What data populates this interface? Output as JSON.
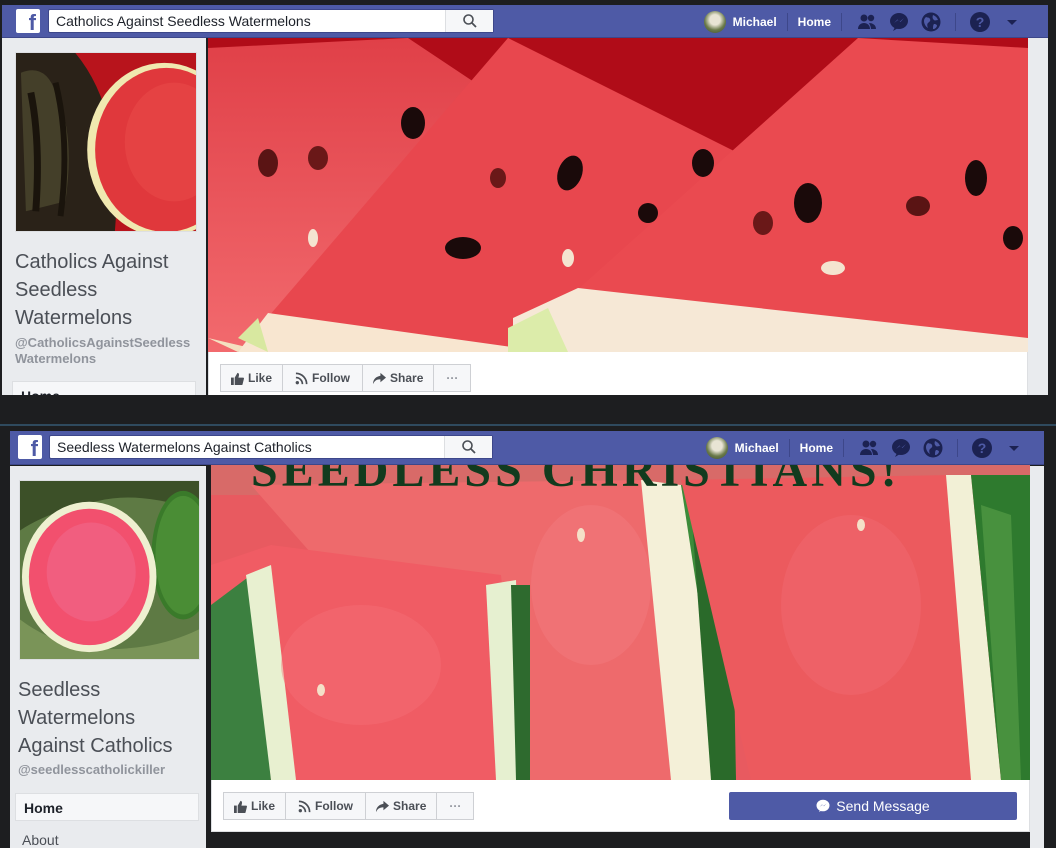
{
  "colors": {
    "brand": "#4e5aa6",
    "page_bg": "#e9ebee",
    "text_dark": "#4b4f56",
    "text_muted": "#90949c"
  },
  "screens": [
    {
      "search": {
        "value": "Catholics Against Seedless Watermelons",
        "icon": "search-icon"
      },
      "nav": {
        "user_name": "Michael",
        "home_label": "Home",
        "icons": [
          "friends-icon",
          "messenger-icon",
          "globe-icon",
          "help-icon",
          "caret-down-icon"
        ]
      },
      "page": {
        "name_lines": [
          "Catholics Against",
          "Seedless",
          "Watermelons"
        ],
        "handle": "@CatholicsAgainstSeedlessWatermelons",
        "profile_image": "watermelon-halves-photo",
        "cover_image": "watermelon-slices-with-seeds-photo"
      },
      "sidebar": {
        "items": [
          "Home"
        ]
      },
      "actions": {
        "like": "Like",
        "follow": "Follow",
        "share": "Share",
        "more": "···"
      }
    },
    {
      "search": {
        "value": "Seedless Watermelons Against Catholics",
        "icon": "search-icon"
      },
      "nav": {
        "user_name": "Michael",
        "home_label": "Home",
        "icons": [
          "friends-icon",
          "messenger-icon",
          "globe-icon",
          "help-icon",
          "caret-down-icon"
        ]
      },
      "page": {
        "name_lines": [
          "Seedless",
          "Watermelons",
          "Against Catholics"
        ],
        "handle": "@seedlesscatholickiller",
        "profile_image": "seedless-watermelon-half-photo",
        "cover_image": "seedless-watermelon-slices-photo",
        "cover_text": "SEEDLESS CHRISTIANS!"
      },
      "sidebar": {
        "items": [
          "Home",
          "About"
        ]
      },
      "actions": {
        "like": "Like",
        "follow": "Follow",
        "share": "Share",
        "more": "···",
        "send_message": "Send Message"
      }
    }
  ]
}
